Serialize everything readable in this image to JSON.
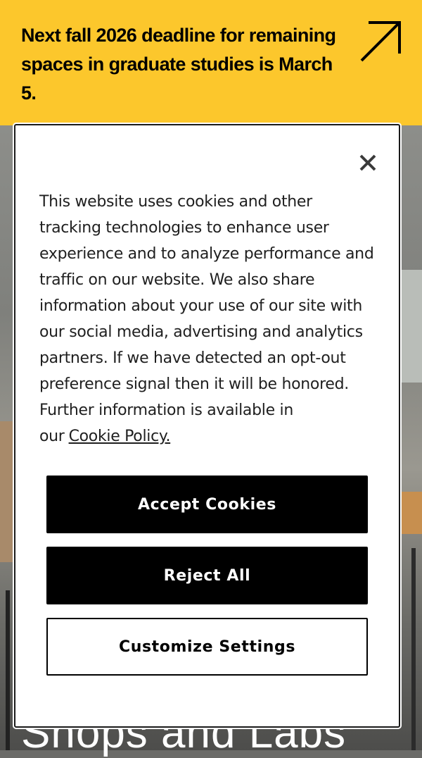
{
  "banner": {
    "text": "Next fall 2026 deadline for remaining spaces in graduate studies is March 5.",
    "icon": "arrow-up-right-icon",
    "background": "#fcc72c"
  },
  "hero": {
    "title": "Shops and Labs"
  },
  "cookie_dialog": {
    "description": "This website uses cookies and other tracking technologies to enhance user experience and to analyze performance and traffic on our website. We also share information about your use of our site with our social media, advertising and analytics partners. If we have detected an opt-out preference signal then it will be honored. Further information is available in our",
    "policy_link": "Cookie Policy.",
    "close_icon": "close-icon",
    "accept_label": "Accept Cookies",
    "reject_label": "Reject All",
    "customize_label": "Customize Settings"
  }
}
